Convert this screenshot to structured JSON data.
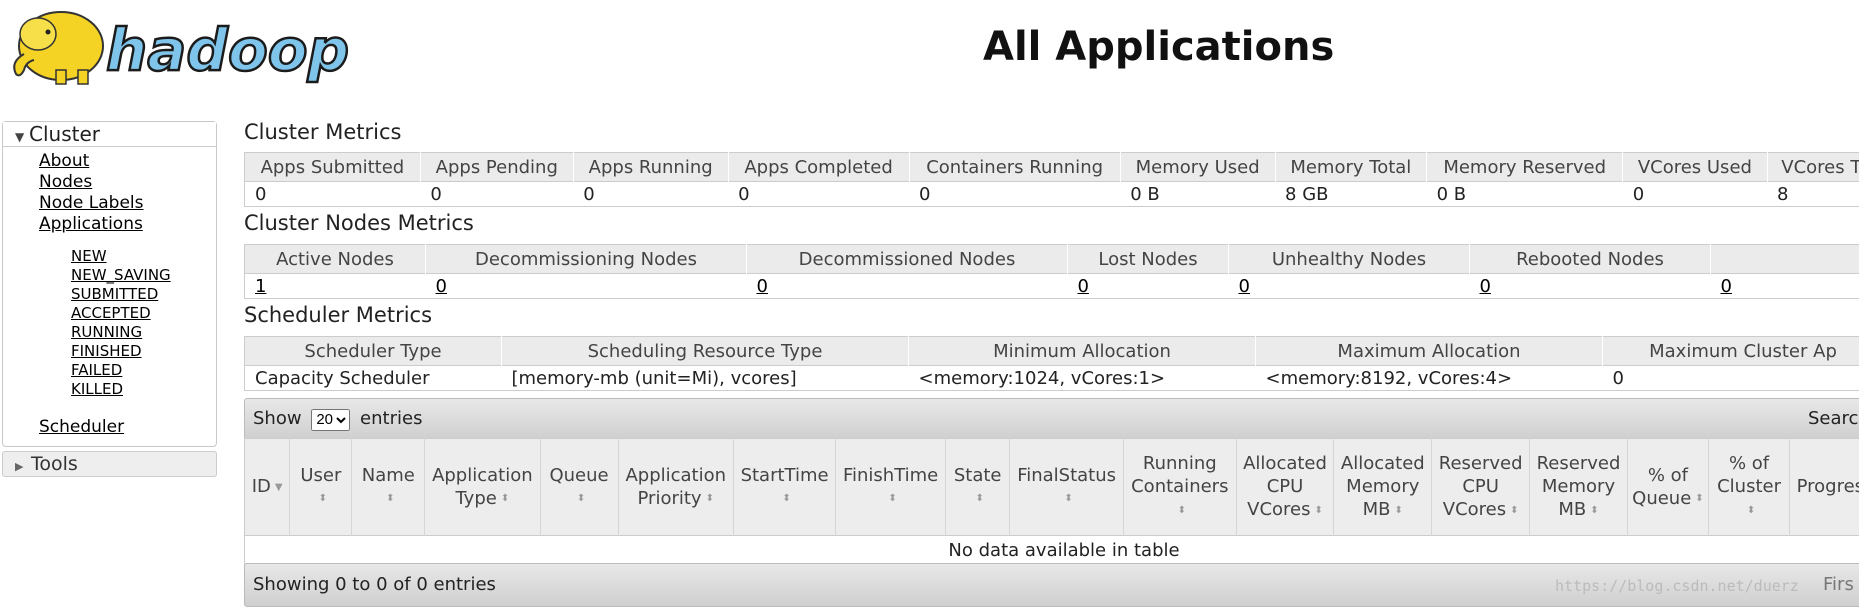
{
  "header": {
    "logo_text": "hadoop",
    "title": "All Applications"
  },
  "nav": {
    "cluster_label": "Cluster",
    "cluster_links": [
      "About",
      "Nodes",
      "Node Labels",
      "Applications"
    ],
    "app_states": [
      "NEW",
      "NEW_SAVING",
      "SUBMITTED",
      "ACCEPTED",
      "RUNNING",
      "FINISHED",
      "FAILED",
      "KILLED"
    ],
    "scheduler_link": "Scheduler",
    "tools_label": "Tools"
  },
  "cluster_metrics": {
    "title": "Cluster Metrics",
    "headers": [
      "Apps Submitted",
      "Apps Pending",
      "Apps Running",
      "Apps Completed",
      "Containers Running",
      "Memory Used",
      "Memory Total",
      "Memory Reserved",
      "VCores Used",
      "VCores To"
    ],
    "values": [
      "0",
      "0",
      "0",
      "0",
      "0",
      "0 B",
      "8 GB",
      "0 B",
      "0",
      "8"
    ]
  },
  "cluster_nodes_metrics": {
    "title": "Cluster Nodes Metrics",
    "headers": [
      "Active Nodes",
      "Decommissioning Nodes",
      "Decommissioned Nodes",
      "Lost Nodes",
      "Unhealthy Nodes",
      "Rebooted Nodes",
      ""
    ],
    "values": [
      "1",
      "0",
      "0",
      "0",
      "0",
      "0",
      "0"
    ]
  },
  "scheduler_metrics": {
    "title": "Scheduler Metrics",
    "headers": [
      "Scheduler Type",
      "Scheduling Resource Type",
      "Minimum Allocation",
      "Maximum Allocation",
      "Maximum Cluster Ap"
    ],
    "values": [
      "Capacity Scheduler",
      "[memory-mb (unit=Mi), vcores]",
      "<memory:1024, vCores:1>",
      "<memory:8192, vCores:4>",
      "0"
    ]
  },
  "apps": {
    "show_label": "Show",
    "entries_label": "entries",
    "page_size": "20",
    "search_label": "Searc",
    "columns": [
      "ID",
      "User",
      "Name",
      "Application Type",
      "Queue",
      "Application Priority",
      "StartTime",
      "FinishTime",
      "State",
      "FinalStatus",
      "Running Containers",
      "Allocated CPU VCores",
      "Allocated Memory MB",
      "Reserved CPU VCores",
      "Reserved Memory MB",
      "% of Queue",
      "% of Cluster",
      "Progres"
    ],
    "empty_message": "No data available in table",
    "info": "Showing 0 to 0 of 0 entries",
    "first_label": "Firs"
  },
  "watermark": "https://blog.csdn.net/duerz"
}
